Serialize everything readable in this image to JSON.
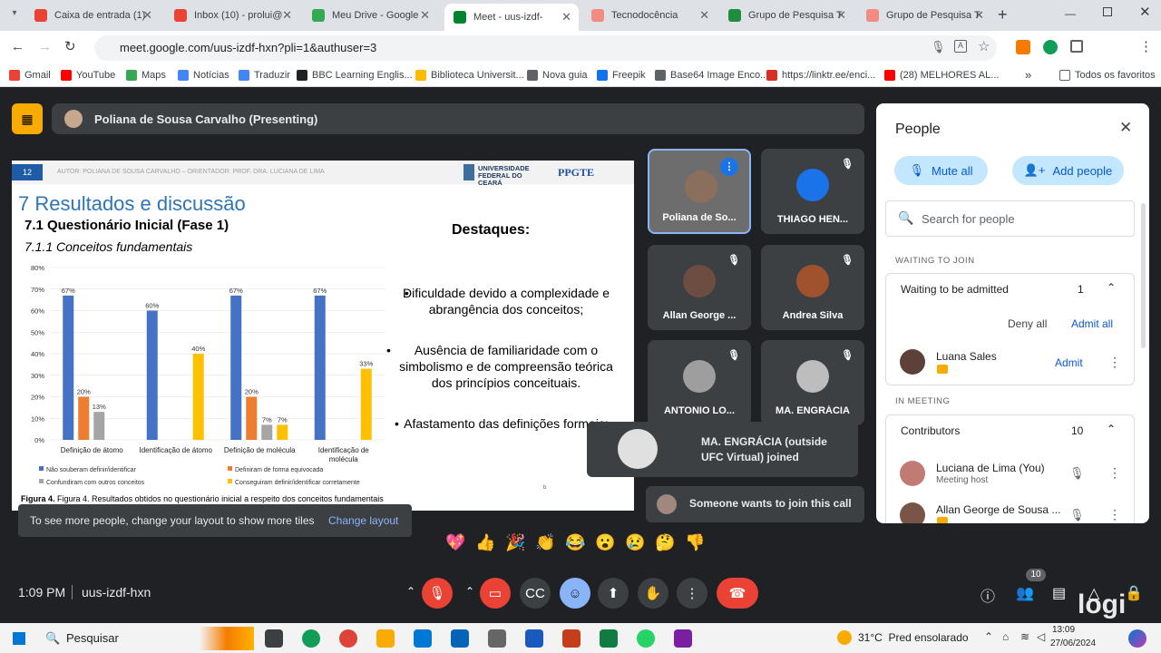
{
  "tabs": [
    {
      "label": "Caixa de entrada (1)",
      "color": "#ea4335"
    },
    {
      "label": "Inbox (10) - prolui@",
      "color": "#ea4335"
    },
    {
      "label": "Meu Drive - Google",
      "color": "#34a853"
    },
    {
      "label": "Meet - uus-izdf-",
      "color": "#00832d"
    },
    {
      "label": "Tecnodocência",
      "color": "#f28b82"
    },
    {
      "label": "Grupo de Pesquisa T",
      "color": "#1e8e3e"
    },
    {
      "label": "Grupo de Pesquisa T",
      "color": "#f28b82"
    }
  ],
  "address": {
    "url": "meet.google.com/uus-izdf-hxn?pli=1&authuser=3"
  },
  "bookmarks": [
    {
      "label": "Gmail",
      "color": "#ea4335"
    },
    {
      "label": "YouTube",
      "color": "#ff0000"
    },
    {
      "label": "Maps",
      "color": "#34a853"
    },
    {
      "label": "Notícias",
      "color": "#4285f4"
    },
    {
      "label": "Traduzir",
      "color": "#4285f4"
    },
    {
      "label": "BBC Learning Englis...",
      "color": "#202124"
    },
    {
      "label": "Biblioteca Universit...",
      "color": "#fbbc04"
    },
    {
      "label": "Nova guia",
      "color": "#5f6368"
    },
    {
      "label": "Freepik",
      "color": "#1273eb"
    },
    {
      "label": "Base64 Image Enco...",
      "color": "#5f6368"
    },
    {
      "label": "https://linktr.ee/enci...",
      "color": "#d93025"
    },
    {
      "label": "(28) MELHORES AL...",
      "color": "#ff0000"
    }
  ],
  "bookmarks_all": "Todos os favoritos",
  "presenter": "Poliana de Sousa Carvalho (Presenting)",
  "slide": {
    "page": "12",
    "author": "AUTOR: POLIANA DE SOUSA CARVALHO – ORIENTADOR: PROF. DRA. LUCIANA DE LIMA",
    "logo1": "UNIVERSIDADE FEDERAL DO CEARÁ",
    "logo2": "PPGTE",
    "title": "7 Resultados e discussão",
    "subtitle": "7.1 Questionário Inicial (Fase 1)",
    "subsub": "7.1.1 Conceitos fundamentais",
    "highlights_title": "Destaques:",
    "bullets": [
      "Dificuldade devido a complexidade e abrangência dos conceitos;",
      "Ausência de familiaridade com o simbolismo e de compreensão teórica dos princípios conceituais.",
      "Afastamento das definições formais;"
    ],
    "caption": "Figura 4. Resultados obtidos no questionário inicial a respeito dos conceitos fundamentais"
  },
  "chart_data": {
    "type": "bar",
    "categories": [
      "Definição de átomo",
      "Identificação de átomo",
      "Definição de molécula",
      "Identificação de molécula"
    ],
    "series": [
      {
        "name": "Não souberam definir/identificar",
        "color": "#4472c4",
        "values": [
          67,
          60,
          67,
          67
        ]
      },
      {
        "name": "Definiram de forma equivocada",
        "color": "#ed7d31",
        "values": [
          20,
          0,
          20,
          0
        ]
      },
      {
        "name": "Confundiram com outros conceitos",
        "color": "#a5a5a5",
        "values": [
          13,
          0,
          7,
          0
        ]
      },
      {
        "name": "Conseguiram definir/identificar corretamente",
        "color": "#ffc000",
        "values": [
          0,
          40,
          7,
          33
        ]
      }
    ],
    "labels": [
      [
        "67%",
        "20%",
        "13%",
        ""
      ],
      [
        "60%",
        "",
        "",
        "40%"
      ],
      [
        "67%",
        "20%",
        "7%",
        "7%"
      ],
      [
        "67%",
        "",
        "",
        "33%"
      ]
    ],
    "yticks": [
      "0%",
      "10%",
      "20%",
      "30%",
      "40%",
      "50%",
      "60%",
      "70%",
      "80%"
    ],
    "ylim": [
      0,
      80
    ]
  },
  "tiles": [
    {
      "name": "Poliana de So...",
      "avatar": "#8a6f5c"
    },
    {
      "name": "THIAGO HEN...",
      "avatar": "#1a73e8"
    },
    {
      "name": "Allan George ...",
      "avatar": "#6d4c41"
    },
    {
      "name": "Andrea Silva",
      "avatar": "#a0522d"
    },
    {
      "name": "ANTONIO LO...",
      "avatar": "#9e9e9e"
    },
    {
      "name": "MA. ENGRÁCIA",
      "avatar": "#bdbdbd"
    }
  ],
  "toast": {
    "text": "MA. ENGRÁCIA (outside UFC Virtual) joined"
  },
  "join_toast": "Someone wants to join this call",
  "layout_toast": {
    "text": "To see more people, change your layout to show more tiles",
    "action": "Change layout"
  },
  "people": {
    "title": "People",
    "mute_all": "Mute all",
    "add_people": "Add people",
    "search_placeholder": "Search for people",
    "waiting_header": "WAITING TO JOIN",
    "waiting_label": "Waiting to be admitted",
    "waiting_count": "1",
    "deny_all": "Deny all",
    "admit_all": "Admit all",
    "waiting_person": "Luana Sales",
    "admit": "Admit",
    "meeting_header": "IN MEETING",
    "contributors_label": "Contributors",
    "contributors_count": "10",
    "members": [
      {
        "name": "Luciana de Lima (You)",
        "role": "Meeting host"
      },
      {
        "name": "Allan George de Sousa ...",
        "role": ""
      }
    ]
  },
  "reactions": [
    "💖",
    "👍",
    "🎉",
    "👏",
    "😂",
    "😮",
    "😢",
    "🤔",
    "👎"
  ],
  "footer": {
    "time": "1:09 PM",
    "code": "uus-izdf-hxn",
    "participants_badge": "10",
    "watermark": "logi"
  },
  "taskbar": {
    "search": "Pesquisar",
    "weather": "31°C  Pred ensolarado",
    "clock_time": "13:09",
    "clock_date": "27/06/2024"
  }
}
